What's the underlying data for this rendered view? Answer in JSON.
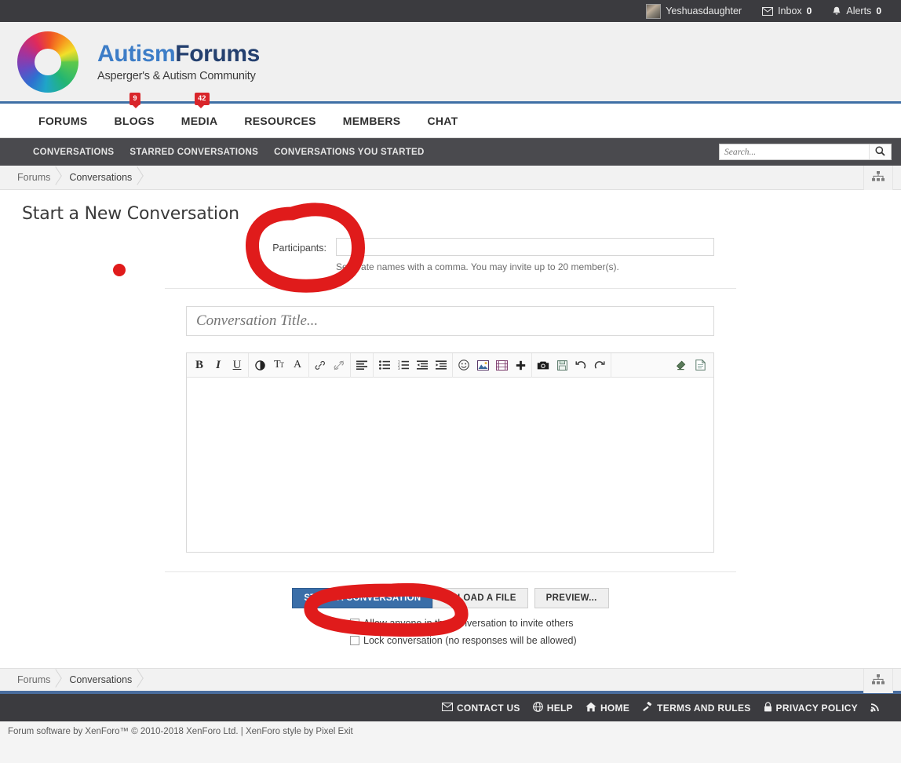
{
  "topbar": {
    "username": "Yeshuasdaughter",
    "inbox_label": "Inbox",
    "inbox_count": "0",
    "alerts_label": "Alerts",
    "alerts_count": "0"
  },
  "brand": {
    "name_part1": "Autism",
    "name_part2": "Forums",
    "tagline": "Asperger's & Autism Community"
  },
  "mainnav": {
    "items": [
      {
        "label": "FORUMS",
        "badge": ""
      },
      {
        "label": "BLOGS",
        "badge": "9"
      },
      {
        "label": "MEDIA",
        "badge": "42"
      },
      {
        "label": "RESOURCES",
        "badge": ""
      },
      {
        "label": "MEMBERS",
        "badge": ""
      },
      {
        "label": "CHAT",
        "badge": ""
      }
    ]
  },
  "subnav": {
    "items": [
      {
        "label": "CONVERSATIONS"
      },
      {
        "label": "STARRED CONVERSATIONS"
      },
      {
        "label": "CONVERSATIONS YOU STARTED"
      }
    ]
  },
  "search": {
    "value": "",
    "placeholder": "Search..."
  },
  "breadcrumb": {
    "items": [
      {
        "label": "Forums"
      },
      {
        "label": "Conversations"
      }
    ]
  },
  "main": {
    "page_title": "Start a New Conversation",
    "participants_label": "Participants:",
    "participants_value": "",
    "participants_hint": "Separate names with a comma. You may invite up to 20 member(s).",
    "title_value": "",
    "title_placeholder": "Conversation Title...",
    "message_value": "",
    "buttons": {
      "submit": "START A CONVERSATION",
      "upload": "UPLOAD A FILE",
      "preview": "PREVIEW..."
    },
    "options": [
      {
        "label": "Allow anyone in the conversation to invite others",
        "checked": false
      },
      {
        "label": "Lock conversation (no responses will be allowed)",
        "checked": false
      }
    ]
  },
  "editor_toolbar": {
    "groups": [
      [
        "bold",
        "italic",
        "underline"
      ],
      [
        "text-contrast",
        "font-size",
        "text-color"
      ],
      [
        "link",
        "unlink"
      ],
      [
        "align-left"
      ],
      [
        "bullet-list",
        "numbered-list",
        "outdent",
        "indent"
      ],
      [
        "smilie",
        "image",
        "media",
        "insert-more"
      ],
      [
        "camera",
        "draft-save",
        "undo",
        "redo"
      ],
      [
        "remove-formatting",
        "toggle-bbcode"
      ]
    ]
  },
  "footer": {
    "links": [
      {
        "icon": "envelope-icon",
        "label": "CONTACT US"
      },
      {
        "icon": "globe-help-icon",
        "label": "HELP"
      },
      {
        "icon": "home-icon",
        "label": "HOME"
      },
      {
        "icon": "gavel-icon",
        "label": "TERMS AND RULES"
      },
      {
        "icon": "lock-icon",
        "label": "PRIVACY POLICY"
      },
      {
        "icon": "rss-icon",
        "label": ""
      }
    ],
    "copyright": "Forum software by XenForo™ © 2010-2018 XenForo Ltd. | XenForo style by Pixel Exit"
  },
  "annotations": {
    "color": "#e01b1b",
    "shapes": [
      {
        "name": "circle-around-participants-label"
      },
      {
        "name": "dot-left-of-participants"
      },
      {
        "name": "circle-around-start-conversation-button"
      }
    ]
  },
  "colors": {
    "accent_blue": "#3a6ea8",
    "header_rule": "#3f6fa5",
    "dark_bar": "#3b3b3f",
    "badge_red": "#d9252a",
    "annotation_red": "#e01b1b"
  }
}
